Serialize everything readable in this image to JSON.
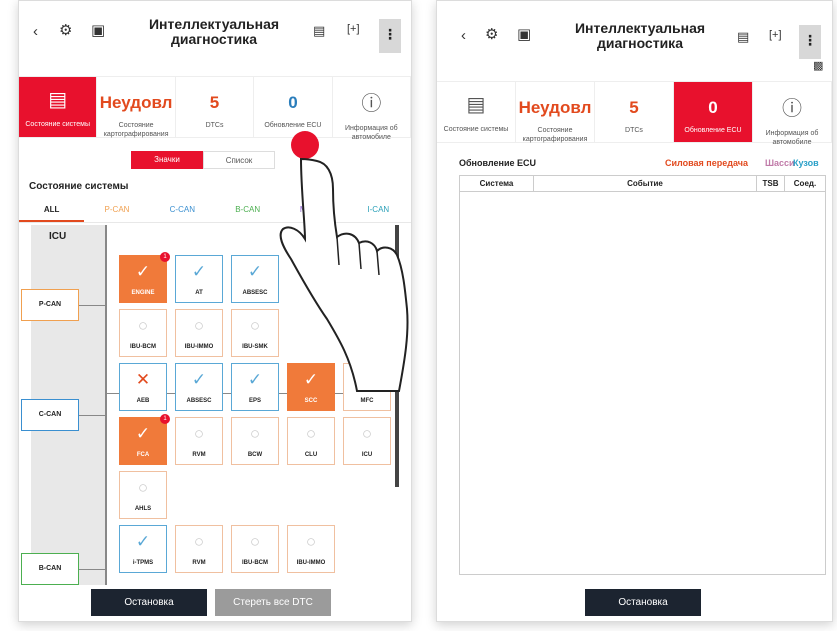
{
  "left": {
    "title_line1": "Интеллектуальная",
    "title_line2": "диагностика",
    "kebab": "⋮",
    "tabs": [
      {
        "big": "",
        "label": "Состояние системы"
      },
      {
        "big": "Неудовл",
        "label": "Состояние картографирования"
      },
      {
        "big": "5",
        "label": "DTCs"
      },
      {
        "big": "0",
        "label": "Обновление ECU"
      },
      {
        "big": "",
        "label": "Информация об автомобиле"
      }
    ],
    "view_toggle": {
      "icons": "Значки",
      "list": "Список"
    },
    "section_title": "Состояние системы",
    "can_tabs": [
      "ALL",
      "P-CAN",
      "C-CAN",
      "B-CAN",
      "M-CAN",
      "I-CAN"
    ],
    "icu_label": "ICU",
    "buses": [
      "P-CAN",
      "C-CAN",
      "B-CAN"
    ],
    "ecus": [
      {
        "name": "ENGINE",
        "status": "ok",
        "orange": true,
        "badge": "1"
      },
      {
        "name": "AT",
        "status": "ok"
      },
      {
        "name": "ABSESC",
        "status": "ok"
      },
      {
        "name": "IBU-BCM",
        "status": "na"
      },
      {
        "name": "IBU-IMMO",
        "status": "na"
      },
      {
        "name": "IBU-SMK",
        "status": "na"
      },
      {
        "name": "AEB",
        "status": "fail"
      },
      {
        "name": "ABSESC",
        "status": "ok"
      },
      {
        "name": "EPS",
        "status": "ok"
      },
      {
        "name": "SCC",
        "status": "ok",
        "orange": true
      },
      {
        "name": "MFC",
        "status": "na"
      },
      {
        "name": "FCA",
        "status": "ok",
        "orange": true,
        "badge": "1"
      },
      {
        "name": "RVM",
        "status": "na"
      },
      {
        "name": "BCW",
        "status": "na"
      },
      {
        "name": "CLU",
        "status": "na"
      },
      {
        "name": "ICU",
        "status": "na"
      },
      {
        "name": "AHLS",
        "status": "na"
      },
      {
        "name": "i-TPMS",
        "status": "ok"
      },
      {
        "name": "RVM",
        "status": "na"
      },
      {
        "name": "IBU-BCM",
        "status": "na"
      },
      {
        "name": "IBU-IMMO",
        "status": "na"
      }
    ],
    "stop_button": "Остановка",
    "clear_button": "Стереть все DTC"
  },
  "right": {
    "title_line1": "Интеллектуальная",
    "title_line2": "диагностика",
    "kebab": "⋮",
    "tabs": [
      {
        "big": "",
        "label": "Состояние системы"
      },
      {
        "big": "Неудовл",
        "label": "Состояние картографирования"
      },
      {
        "big": "5",
        "label": "DTCs"
      },
      {
        "big": "0",
        "label": "Обновление ECU"
      },
      {
        "big": "",
        "label": "Информация об автомобиле"
      }
    ],
    "panel_title": "Обновление ECU",
    "filters": {
      "powertrain": "Силовая передача",
      "chassis": "Шасси",
      "body": "Кузов"
    },
    "columns": [
      "Система",
      "Событие",
      "TSB",
      "Соед."
    ],
    "stop_button": "Остановка"
  },
  "colors": {
    "accent_red": "#e8112d",
    "orange": "#f07a3a",
    "ok_blue": "#5aa8d6"
  }
}
